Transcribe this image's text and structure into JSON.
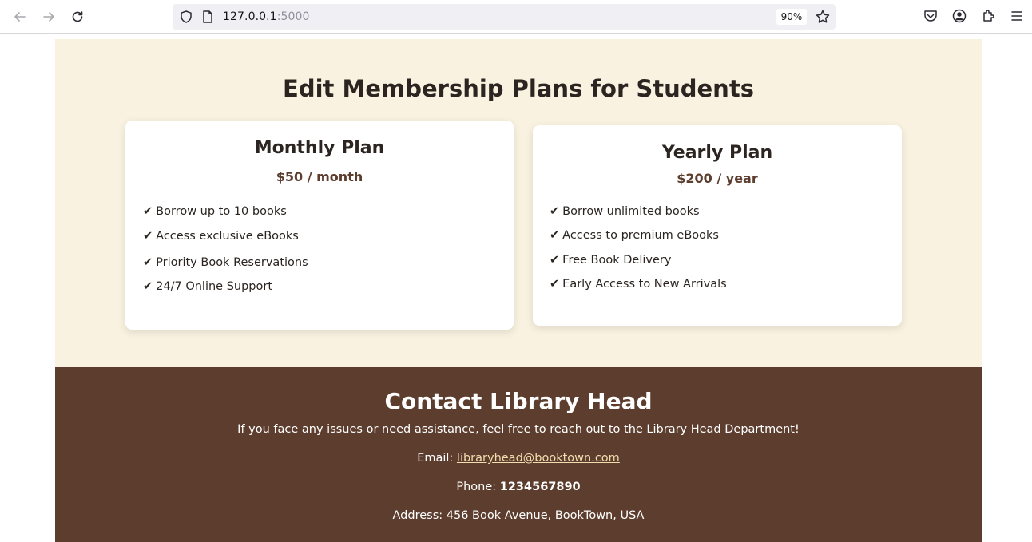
{
  "browser": {
    "url_host": "127.0.0.1",
    "url_port": ":5000",
    "zoom": "90%"
  },
  "page": {
    "title": "Edit Membership Plans for Students",
    "plans": [
      {
        "name": "Monthly Plan",
        "price": "$50 / month",
        "features": [
          "Borrow up to 10 books",
          "Access exclusive eBooks",
          "Priority Book Reservations",
          "24/7 Online Support"
        ]
      },
      {
        "name": "Yearly Plan",
        "price": "$200 / year",
        "features": [
          "Borrow unlimited books",
          "Access to premium eBooks",
          "Free Book Delivery",
          "Early Access to New Arrivals"
        ]
      }
    ],
    "check_glyph": "✔",
    "contact": {
      "title": "Contact Library Head",
      "description": "If you face any issues or need assistance, feel free to reach out to the Library Head Department!",
      "email_label": "Email: ",
      "email": "libraryhead@booktown.com",
      "phone_label": "Phone: ",
      "phone": "1234567890",
      "address_label": "Address: ",
      "address": "456 Book Avenue, BookTown, USA"
    }
  },
  "colors": {
    "plans_background": "#faf2e0",
    "contact_background": "#5c3d2e",
    "price_color": "#5c3d2e",
    "link_color": "#f3dcae"
  }
}
